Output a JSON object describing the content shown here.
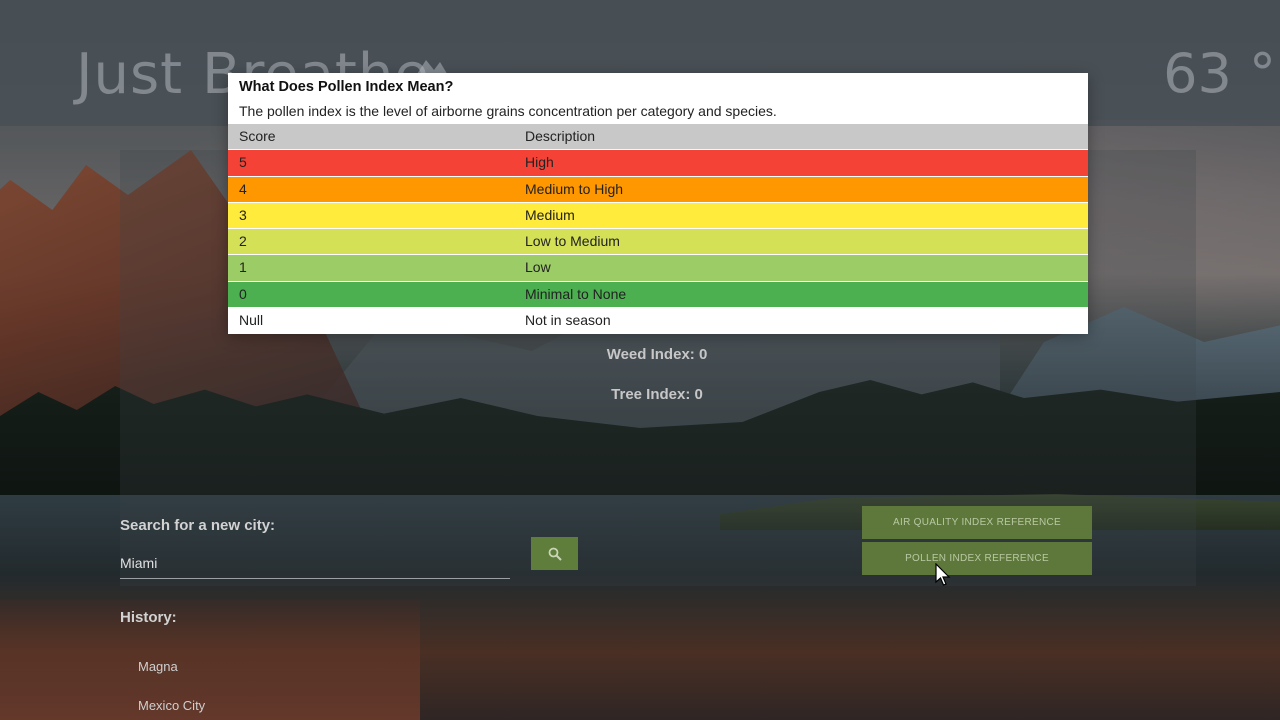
{
  "app": {
    "brand": "Just Breathe",
    "temperature": "63 °"
  },
  "indices": {
    "weed": "Weed Index: 0",
    "tree": "Tree Index: 0"
  },
  "search": {
    "label": "Search for a new city:",
    "value": "Miami",
    "button_icon": "search-icon"
  },
  "history": {
    "label": "History:",
    "items": [
      "Magna",
      "Mexico City"
    ]
  },
  "references": {
    "air_quality": "AIR QUALITY INDEX REFERENCE",
    "pollen": "POLLEN INDEX REFERENCE"
  },
  "modal": {
    "title": "What Does Pollen Index Mean?",
    "description": "The pollen index is the level of airborne grains concentration per category and species.",
    "headers": {
      "score": "Score",
      "description": "Description"
    },
    "rows": [
      {
        "score": "5",
        "description": "High",
        "color": "#f44336"
      },
      {
        "score": "4",
        "description": "Medium to High",
        "color": "#ff9800"
      },
      {
        "score": "3",
        "description": "Medium",
        "color": "#ffeb3b"
      },
      {
        "score": "2",
        "description": "Low to Medium",
        "color": "#d4e157"
      },
      {
        "score": "1",
        "description": "Low",
        "color": "#9ccc65"
      },
      {
        "score": "0",
        "description": "Minimal to None",
        "color": "#4caf50"
      },
      {
        "score": "Null",
        "description": "Not in season",
        "color": "#ffffff"
      }
    ],
    "header_color": "#c8c8c8"
  },
  "colors": {
    "accent": "#5d783a"
  }
}
